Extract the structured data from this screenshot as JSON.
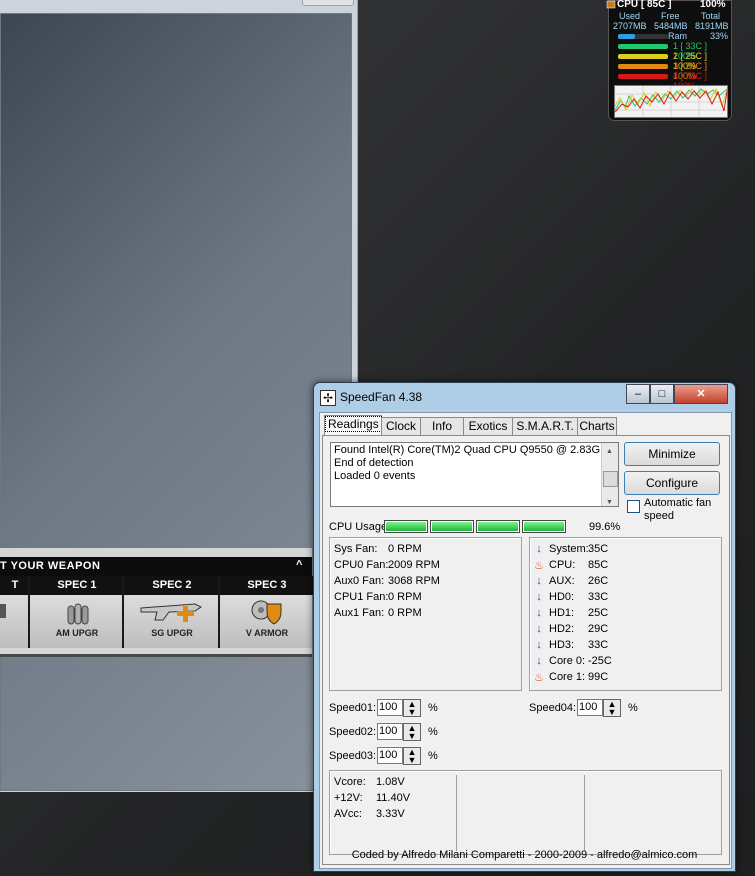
{
  "gadget": {
    "cpu_label": "CPU [ 85C ]",
    "cpu_percent": "100%",
    "used_label": "Used",
    "free_label": "Free",
    "total_label": "Total",
    "used_value": "2707MB",
    "free_value": "5484MB",
    "total_value": "8191MB",
    "ram_label": "Ram",
    "ram_percent": "33%",
    "cores": [
      {
        "label": "1 [ 33C ] 100%",
        "color": "#1fc86a"
      },
      {
        "label": "2 [ 25C ] 100%",
        "color": "#d8d01c"
      },
      {
        "label": "3 [ 29C ] 100%",
        "color": "#e08a12"
      },
      {
        "label": "4 [ 33C ] 100%",
        "color": "#d81818"
      }
    ]
  },
  "weapon_panel": {
    "header": "T YOUR WEAPON",
    "caret": "^",
    "tabs": [
      {
        "title": "T",
        "label": ""
      },
      {
        "title": "SPEC 1",
        "label": "AM UPGR"
      },
      {
        "title": "SPEC 2",
        "label": "SG UPGR"
      },
      {
        "title": "SPEC 3",
        "label": "V ARMOR"
      }
    ]
  },
  "speedfan": {
    "title": "SpeedFan 4.38",
    "icon": "fan-icon",
    "tabs": [
      "Readings",
      "Clock",
      "Info",
      "Exotics",
      "S.M.A.R.T.",
      "Charts"
    ],
    "active_tab": "Readings",
    "log_lines": [
      "Found Intel(R) Core(TM)2 Quad CPU Q9550 @ 2.83GHz",
      "End of detection",
      "Loaded 0 events"
    ],
    "minimize_label": "Minimize",
    "configure_label": "Configure",
    "auto_fan_label": "Automatic fan speed",
    "cpu_usage_label": "CPU Usage",
    "cpu_usage_value": "99.6%",
    "fans": [
      {
        "name": "Sys Fan:",
        "value": "0 RPM"
      },
      {
        "name": "CPU0 Fan:",
        "value": "2009 RPM"
      },
      {
        "name": "Aux0 Fan:",
        "value": "3068 RPM"
      },
      {
        "name": "CPU1 Fan:",
        "value": "0 RPM"
      },
      {
        "name": "Aux1 Fan:",
        "value": "0 RPM"
      }
    ],
    "temps": [
      {
        "name": "System:",
        "value": "35C",
        "icon": "down-arrow-icon"
      },
      {
        "name": "CPU:",
        "value": "85C",
        "icon": "flame-icon"
      },
      {
        "name": "AUX:",
        "value": "26C",
        "icon": "down-arrow-icon"
      },
      {
        "name": "HD0:",
        "value": "33C",
        "icon": "down-arrow-icon"
      },
      {
        "name": "HD1:",
        "value": "25C",
        "icon": "down-arrow-icon"
      },
      {
        "name": "HD2:",
        "value": "29C",
        "icon": "down-arrow-icon"
      },
      {
        "name": "HD3:",
        "value": "33C",
        "icon": "down-arrow-icon"
      },
      {
        "name": "Core 0:",
        "value": "-25C",
        "icon": "down-arrow-icon"
      },
      {
        "name": "Core 1:",
        "value": "99C",
        "icon": "flame-icon"
      }
    ],
    "speeds": [
      {
        "name": "Speed01:",
        "value": "100",
        "unit": "%"
      },
      {
        "name": "Speed02:",
        "value": "100",
        "unit": "%"
      },
      {
        "name": "Speed03:",
        "value": "100",
        "unit": "%"
      },
      {
        "name": "Speed04:",
        "value": "100",
        "unit": "%"
      }
    ],
    "voltages": [
      {
        "name": "Vcore:",
        "value": "1.08V"
      },
      {
        "name": "+12V:",
        "value": "11.40V"
      },
      {
        "name": "AVcc:",
        "value": "3.33V"
      }
    ],
    "footer": "Coded by Alfredo Milani Comparetti - 2000-2009 - alfredo@almico.com"
  }
}
